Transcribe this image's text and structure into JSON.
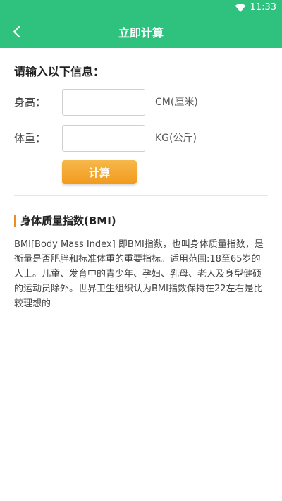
{
  "status": {
    "time": "11:33"
  },
  "appbar": {
    "title": "立即计算",
    "back_icon": "chevron-left-icon"
  },
  "form": {
    "heading": "请输入以下信息：",
    "height_label": "身高：",
    "height_value": "",
    "height_unit": "CM(厘米)",
    "weight_label": "体重：",
    "weight_value": "",
    "weight_unit": "KG(公斤)",
    "calc_label": "计算"
  },
  "info": {
    "title": "身体质量指数(BMI)",
    "body": "BMI[Body Mass Index] 即BMI指数，也叫身体质量指数，是衡量是否肥胖和标准体重的重要指标。适用范围:18至65岁的人士。儿童、发育中的青少年、孕妇、乳母、老人及身型健硕的运动员除外。世界卫生组织认为BMI指数保持在22左右是比较理想的"
  },
  "colors": {
    "primary": "#2ec27e",
    "button": "#f29a1e",
    "accent": "#f08a24"
  }
}
